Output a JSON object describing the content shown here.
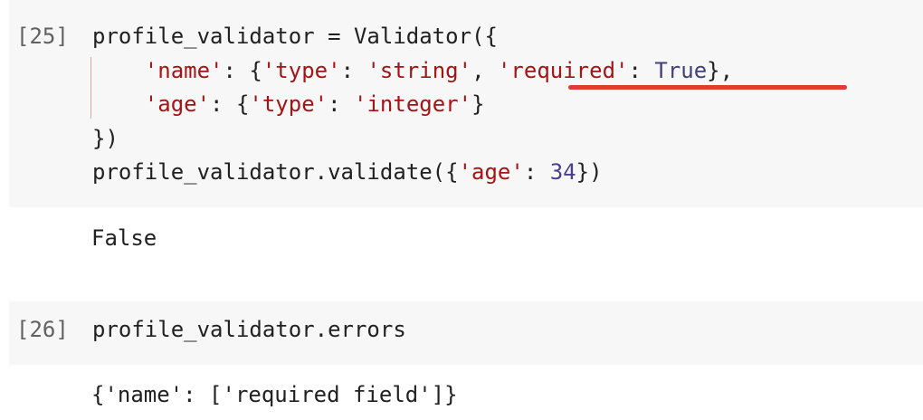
{
  "cells": [
    {
      "prompt": "[25]",
      "lines": [
        [
          {
            "t": "profile_validator = Validator({",
            "c": "punc"
          }
        ],
        [
          {
            "t": "    ",
            "c": "punc"
          },
          {
            "t": "'name'",
            "c": "str"
          },
          {
            "t": ": {",
            "c": "punc"
          },
          {
            "t": "'type'",
            "c": "str"
          },
          {
            "t": ": ",
            "c": "punc"
          },
          {
            "t": "'string'",
            "c": "str"
          },
          {
            "t": ", ",
            "c": "punc"
          },
          {
            "t": "'required'",
            "c": "str"
          },
          {
            "t": ": ",
            "c": "punc"
          },
          {
            "t": "True",
            "c": "kw"
          },
          {
            "t": "},",
            "c": "punc"
          }
        ],
        [
          {
            "t": "    ",
            "c": "punc"
          },
          {
            "t": "'age'",
            "c": "str"
          },
          {
            "t": ": {",
            "c": "punc"
          },
          {
            "t": "'type'",
            "c": "str"
          },
          {
            "t": ": ",
            "c": "punc"
          },
          {
            "t": "'integer'",
            "c": "str"
          },
          {
            "t": "}",
            "c": "punc"
          }
        ],
        [
          {
            "t": "})",
            "c": "punc"
          }
        ],
        [
          {
            "t": "profile_validator.validate({",
            "c": "punc"
          },
          {
            "t": "'age'",
            "c": "str"
          },
          {
            "t": ": ",
            "c": "punc"
          },
          {
            "t": "34",
            "c": "num"
          },
          {
            "t": "})",
            "c": "punc"
          }
        ]
      ],
      "output": "False"
    },
    {
      "prompt": "[26]",
      "lines": [
        [
          {
            "t": "profile_validator.errors",
            "c": "punc"
          }
        ]
      ],
      "output": "{'name': ['required field']}"
    }
  ],
  "colors": {
    "string": "#a31515",
    "number": "#4a3f8f",
    "keyword": "#44417a",
    "highlight_underline": "#e53935",
    "cell_background": "#f7f7f7"
  }
}
